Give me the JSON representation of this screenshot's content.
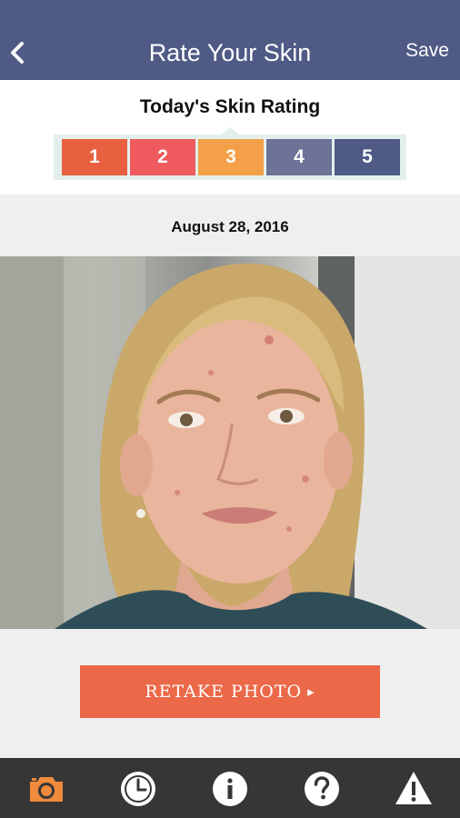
{
  "header": {
    "title": "Rate Your Skin",
    "save_label": "Save",
    "back_icon": "chevron-left-icon",
    "background": "#4f5a85"
  },
  "rating": {
    "heading": "Today's Skin Rating",
    "options": [
      {
        "label": "1",
        "color": "#e8603f"
      },
      {
        "label": "2",
        "color": "#ee5a5e"
      },
      {
        "label": "3",
        "color": "#f4a048"
      },
      {
        "label": "4",
        "color": "#6d7396"
      },
      {
        "label": "5",
        "color": "#4f5a85"
      }
    ]
  },
  "date": "August 28, 2016",
  "retake": {
    "label": "RETAKE PHOTO",
    "chevron": "▸",
    "color": "#eb6848"
  },
  "tabbar": {
    "items": [
      {
        "icon": "camera-icon",
        "active": true
      },
      {
        "icon": "history-clock-icon",
        "active": false
      },
      {
        "icon": "info-icon",
        "active": false
      },
      {
        "icon": "help-icon",
        "active": false
      },
      {
        "icon": "warning-icon",
        "active": false
      }
    ],
    "active_color": "#f08a3c"
  }
}
